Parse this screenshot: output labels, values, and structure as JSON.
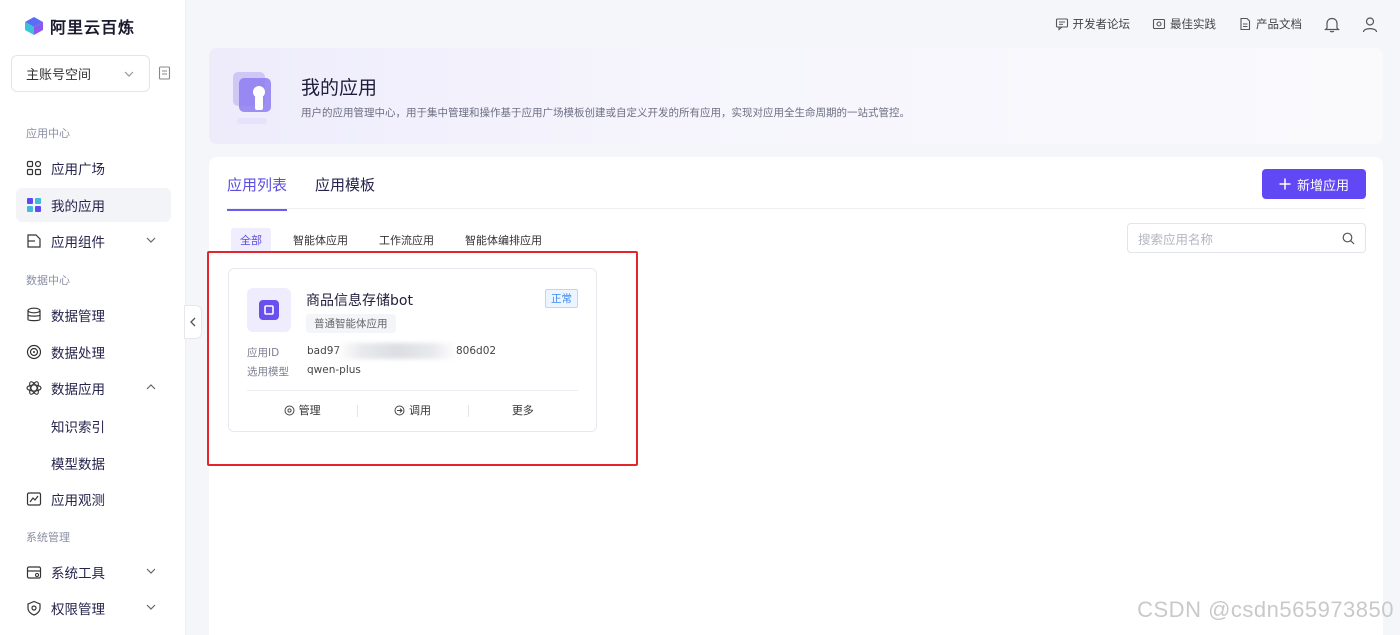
{
  "brand": {
    "name": "阿里云百炼"
  },
  "space": {
    "label": "主账号空间"
  },
  "sidebar": {
    "sections": [
      {
        "label": "应用中心"
      },
      {
        "label": "数据中心"
      },
      {
        "label": "系统管理"
      }
    ],
    "items": [
      {
        "label": "应用广场"
      },
      {
        "label": "我的应用"
      },
      {
        "label": "应用组件"
      },
      {
        "label": "数据管理"
      },
      {
        "label": "数据处理"
      },
      {
        "label": "数据应用"
      },
      {
        "label": "知识索引"
      },
      {
        "label": "模型数据"
      },
      {
        "label": "应用观测"
      },
      {
        "label": "系统工具"
      },
      {
        "label": "权限管理"
      }
    ]
  },
  "topbar": {
    "links": [
      {
        "label": "开发者论坛",
        "icon": "forum-icon"
      },
      {
        "label": "最佳实践",
        "icon": "practice-icon"
      },
      {
        "label": "产品文档",
        "icon": "doc-icon"
      }
    ]
  },
  "header": {
    "title": "我的应用",
    "description": "用户的应用管理中心，用于集中管理和操作基于应用广场模板创建或自定义开发的所有应用，实现对应用全生命周期的一站式管控。"
  },
  "main": {
    "tabs": [
      {
        "label": "应用列表"
      },
      {
        "label": "应用模板"
      }
    ],
    "new_button": "新增应用",
    "filters": [
      {
        "label": "全部"
      },
      {
        "label": "智能体应用"
      },
      {
        "label": "工作流应用"
      },
      {
        "label": "智能体编排应用"
      }
    ],
    "search_placeholder": "搜索应用名称"
  },
  "app_card": {
    "name": "商品信息存储bot",
    "type": "普通智能体应用",
    "status": "正常",
    "id_label": "应用ID",
    "id_prefix": "bad97",
    "id_suffix": "806d02",
    "model_label": "选用模型",
    "model_value": "qwen-plus",
    "actions": [
      {
        "label": "管理"
      },
      {
        "label": "调用"
      },
      {
        "label": "更多"
      }
    ]
  },
  "watermark": "CSDN @csdn565973850",
  "colors": {
    "accent": "#6049f5",
    "highlight_border": "#e3262b",
    "status": "#3b8af0"
  }
}
